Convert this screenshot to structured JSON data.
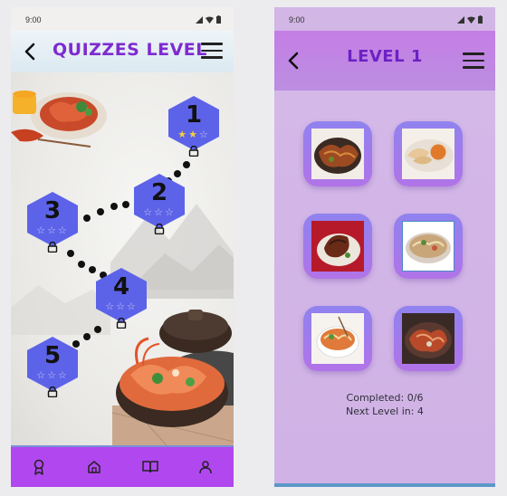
{
  "left_screen": {
    "status_time": "9:00",
    "title": "QUIZZES LEVEL",
    "levels": [
      {
        "number": "1",
        "stars": [
          "filled",
          "filled",
          "empty"
        ],
        "locked": true
      },
      {
        "number": "2",
        "stars": [
          "empty",
          "empty",
          "empty"
        ],
        "locked": true
      },
      {
        "number": "3",
        "stars": [
          "empty",
          "empty",
          "empty"
        ],
        "locked": true
      },
      {
        "number": "4",
        "stars": [
          "empty",
          "empty",
          "empty"
        ],
        "locked": true
      },
      {
        "number": "5",
        "stars": [
          "empty",
          "empty",
          "empty"
        ],
        "locked": true
      }
    ],
    "nav_icons": [
      "award-icon",
      "home-icon",
      "book-icon",
      "user-icon"
    ],
    "colors": {
      "title": "#7e2ad0",
      "level_hex": "#5d63e8",
      "nav_bar": "#b147ee"
    }
  },
  "right_screen": {
    "status_time": "9:00",
    "title": "LEVEL 1",
    "foods": [
      "fried-noodles-image",
      "dumplings-and-soup-image",
      "grilled-meat-image",
      "noodle-soup-image",
      "shrimp-noodle-bowl-image",
      "spicy-stir-fry-image"
    ],
    "completed_text": "Completed: 0/6",
    "next_level_text": "Next Level in: 4",
    "colors": {
      "title": "#6b22c4",
      "background": "#d2b6e6",
      "card": "#9b7cee"
    }
  }
}
